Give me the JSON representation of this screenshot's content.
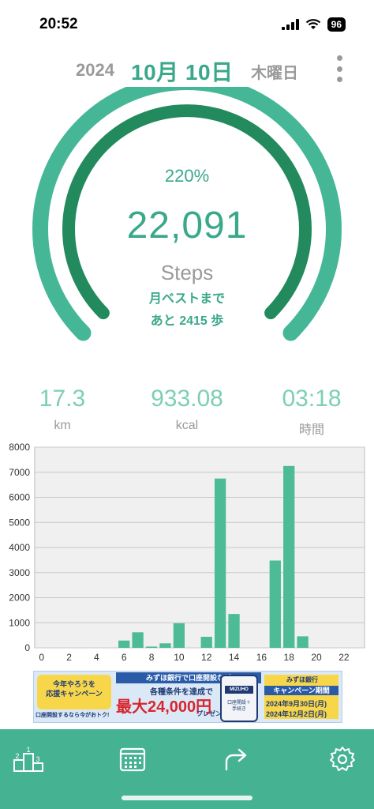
{
  "status_bar": {
    "time": "20:52",
    "battery": "96"
  },
  "header": {
    "year": "2024",
    "month_day": "10月 10日",
    "weekday": "木曜日"
  },
  "summary": {
    "percent": "220%",
    "steps": "22,091",
    "steps_unit": "Steps",
    "best_line1": "月ベストまで",
    "best_line2": "あと 2415 歩"
  },
  "goal_progress": 2.2,
  "stats": [
    {
      "value": "17.3",
      "label": "km"
    },
    {
      "value": "933.08",
      "label": "kcal"
    },
    {
      "value": "03:18",
      "label": "時間"
    }
  ],
  "chart_data": {
    "type": "bar",
    "x": [
      6,
      7,
      8,
      9,
      10,
      12,
      13,
      14,
      17,
      18,
      19
    ],
    "values": [
      290,
      620,
      50,
      180,
      980,
      440,
      6750,
      1350,
      3480,
      7250,
      460
    ],
    "xlim": [
      -0.5,
      23.5
    ],
    "ylim": [
      0,
      8000
    ],
    "xticks": [
      "0",
      "2",
      "4",
      "6",
      "8",
      "10",
      "12",
      "14",
      "16",
      "18",
      "20",
      "22"
    ],
    "yticks": [
      "0",
      "1000",
      "2000",
      "3000",
      "4000",
      "5000",
      "6000",
      "7000",
      "8000"
    ],
    "grid": true,
    "title": "",
    "xlabel": "",
    "ylabel": ""
  },
  "ad": {
    "left_title": "今年やろうを\n応援キャンペーン",
    "left_sub": "口座開設するなら今がおトク!",
    "top_text": "みずほ銀行で口座開設など",
    "mid_text": "各種条件を達成で",
    "amount": "最大24,000円",
    "present": "プレゼント",
    "phone_logo": "MIZUHO",
    "phone_text": "口座開設＋\n手続き",
    "right_head": "みずほ銀行",
    "right_title": "キャンペーン期間",
    "right_date1": "2024年9月30日(月)",
    "right_date2": "2024年12月2日(月)"
  },
  "colors": {
    "accent": "#3aa88a",
    "gauge_outer": "#45b797",
    "gauge_inner": "#238a5e",
    "tab_bar": "#45b392",
    "bar": "#4cbb96"
  },
  "tabs": [
    {
      "icon": "ranking-icon"
    },
    {
      "icon": "calendar-icon"
    },
    {
      "icon": "share-icon"
    },
    {
      "icon": "gear-icon"
    }
  ]
}
